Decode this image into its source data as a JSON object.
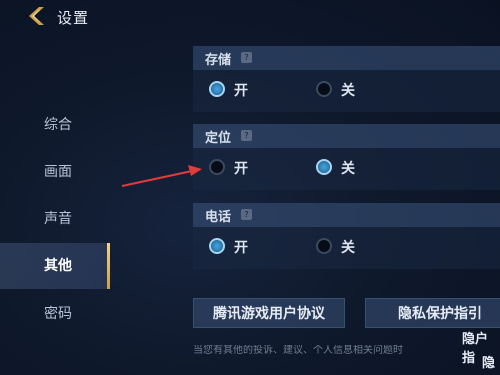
{
  "header": {
    "title": "设置",
    "back_icon": "chevron-left-icon"
  },
  "sidebar": {
    "items": [
      {
        "label": "综合",
        "active": false
      },
      {
        "label": "画面",
        "active": false
      },
      {
        "label": "声音",
        "active": false
      },
      {
        "label": "其他",
        "active": true
      },
      {
        "label": "密码",
        "active": false
      }
    ]
  },
  "sections": [
    {
      "title": "存储",
      "help": "?",
      "options": [
        {
          "label": "开",
          "selected": true
        },
        {
          "label": "关",
          "selected": false
        }
      ]
    },
    {
      "title": "定位",
      "help": "?",
      "options": [
        {
          "label": "开",
          "selected": false
        },
        {
          "label": "关",
          "selected": true
        }
      ]
    },
    {
      "title": "电话",
      "help": "?",
      "options": [
        {
          "label": "开",
          "selected": true
        },
        {
          "label": "关",
          "selected": false
        }
      ]
    }
  ],
  "buttons": {
    "agreement": "腾讯游戏用户协议",
    "privacy": "隐私保护指引"
  },
  "side_links": {
    "first": "隐户指",
    "second": "隐"
  },
  "notice": "当您有其他的投诉、建议、个人信息相关问题时",
  "colors": {
    "accent": "#c9a04c",
    "radio_on": "#2f7fb6",
    "arrow": "#e23b3b"
  }
}
